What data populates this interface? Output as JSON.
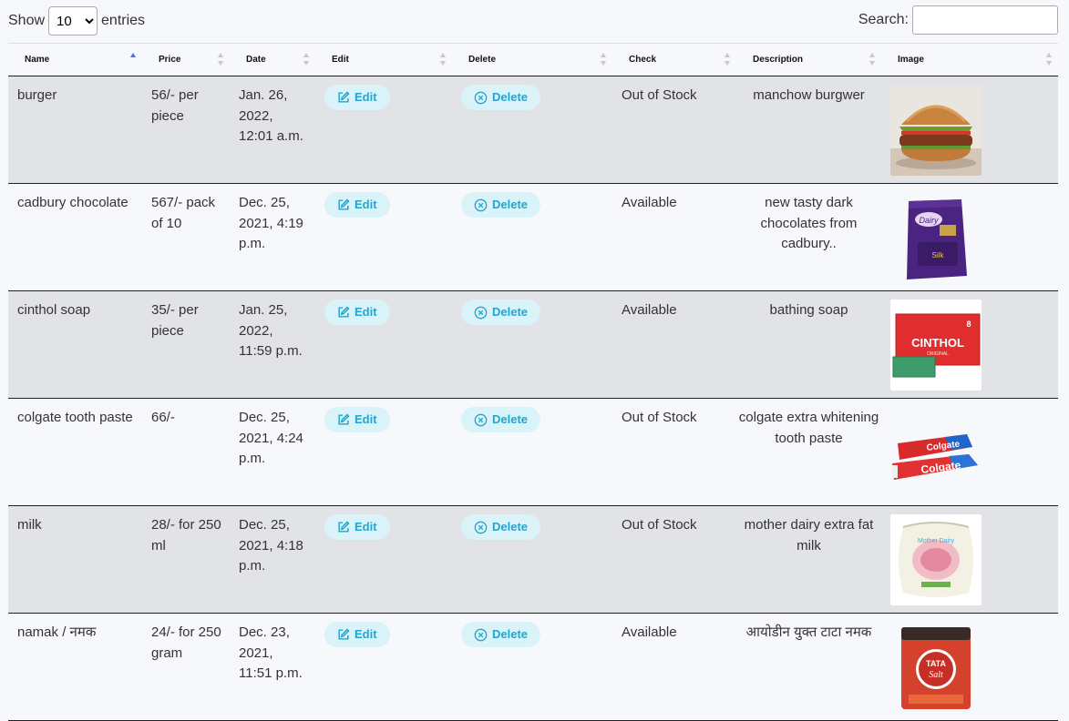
{
  "length_menu": {
    "label_before": "Show",
    "selected": "10",
    "label_after": "entries"
  },
  "search": {
    "label": "Search:",
    "value": "",
    "placeholder": ""
  },
  "columns": [
    "Name",
    "Price",
    "Date",
    "Edit",
    "Delete",
    "Check",
    "Description",
    "Image"
  ],
  "sorted_column": "Name",
  "sort_direction": "ascending",
  "buttons": {
    "edit_label": "Edit",
    "delete_label": "Delete"
  },
  "colors": {
    "pill_bg": "#d9f3f8",
    "pill_text": "#20a6cf",
    "row_shade": "#e1e3e7",
    "sort_active": "#5a6fd0"
  },
  "rows": [
    {
      "name": "burger",
      "price": "56/- per piece",
      "date": "Jan. 26, 2022, 12:01 a.m.",
      "check": "Out of Stock",
      "description": "manchow burgwer",
      "image": "burger-photo"
    },
    {
      "name": "cadbury chocolate",
      "price": "567/- pack of 10",
      "date": "Dec. 25, 2021, 4:19 p.m.",
      "check": "Available",
      "description": "new tasty dark chocolates from cadbury..",
      "image": "chocolate-pack-photo"
    },
    {
      "name": "cinthol soap",
      "price": "35/- per piece",
      "date": "Jan. 25, 2022, 11:59 p.m.",
      "check": "Available",
      "description": "bathing soap",
      "image": "soap-box-photo"
    },
    {
      "name": "colgate tooth paste",
      "price": "66/-",
      "date": "Dec. 25, 2021, 4:24 p.m.",
      "check": "Out of Stock",
      "description": "colgate extra whitening tooth paste",
      "image": "toothpaste-photo"
    },
    {
      "name": "milk",
      "price": "28/- for 250 ml",
      "date": "Dec. 25, 2021, 4:18 p.m.",
      "check": "Out of Stock",
      "description": "mother dairy extra fat milk",
      "image": "milk-pouch-photo"
    },
    {
      "name": "namak / नमक",
      "price": "24/- for 250 gram",
      "date": "Dec. 23, 2021, 11:51 p.m.",
      "check": "Available",
      "description": "आयोडीन युक्त टाटा नमक",
      "image": "salt-packet-photo"
    }
  ]
}
